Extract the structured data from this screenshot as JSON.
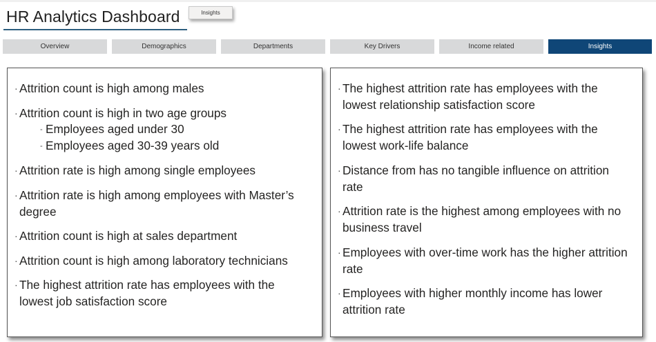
{
  "header": {
    "title": "HR Analytics Dashboard",
    "page_badge": "Insights"
  },
  "tabs": [
    {
      "label": "Overview",
      "active": false
    },
    {
      "label": "Demographics",
      "active": false
    },
    {
      "label": "Departments",
      "active": false
    },
    {
      "label": "Key Drivers",
      "active": false
    },
    {
      "label": "Income related",
      "active": false
    },
    {
      "label": "Insights",
      "active": true
    }
  ],
  "left_panel": {
    "items": [
      "Attrition count is high among males",
      "Attrition count is high in two age groups",
      "Attrition rate is high among single employees",
      "Attrition rate is high among employees with Master’s degree",
      "Attrition count is high at sales department",
      "Attrition count is high among laboratory technicians",
      "The highest attrition rate has employees with the lowest job satisfaction score"
    ],
    "age_groups": [
      "Employees aged under 30",
      "Employees aged 30-39 years old"
    ]
  },
  "right_panel": {
    "items": [
      "The highest attrition rate has employees with the lowest relationship satisfaction score",
      "The highest attrition rate has employees with the lowest work-life balance",
      "Distance from has no tangible influence on attrition rate",
      "Attrition rate is the highest among employees with no business travel",
      "Employees with over-time work has the higher attrition rate",
      "Employees with higher monthly income has lower attrition rate"
    ]
  },
  "colors": {
    "active_tab": "#0f4677",
    "inactive_tab": "#d8d9da",
    "title_underline": "#2c5d7e"
  }
}
